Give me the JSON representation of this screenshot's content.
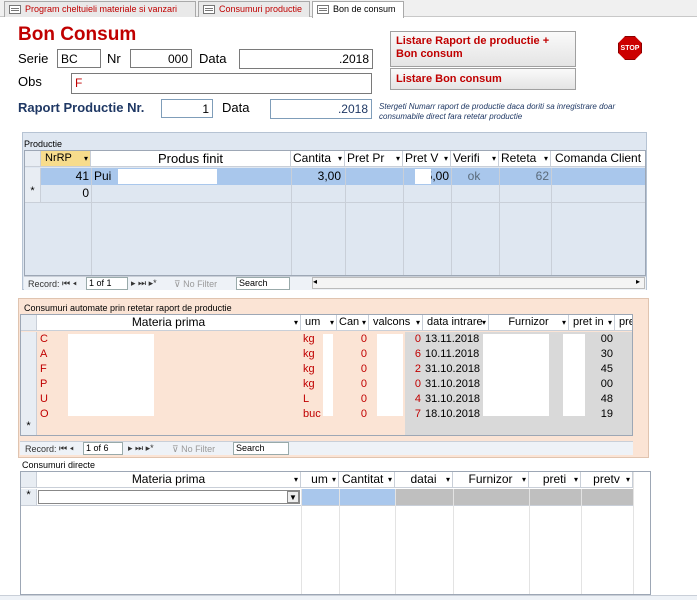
{
  "tabs": [
    {
      "label": "Program cheltuieli materiale si vanzari"
    },
    {
      "label": "Consumuri productie"
    },
    {
      "label": "Bon de consum"
    }
  ],
  "form": {
    "title": "Bon Consum",
    "serie_label": "Serie",
    "serie_value": "BC",
    "nr_label": "Nr",
    "nr_value": "000",
    "data_label": "Data",
    "data_value": ".2018",
    "obs_label": "Obs",
    "obs_value": "F",
    "raport_label": "Raport Productie Nr.",
    "raport_value": "1",
    "data2_label": "Data",
    "data2_value": ".2018",
    "hint": "Stergeti Numarr raport de productie daca doriti sa inregistrare doar consumabile direct fara retetar productie",
    "btn_listare_raport": "Listare Raport de productie + Bon consum",
    "btn_listare_bon": "Listare Bon consum",
    "stop_label": "STOP"
  },
  "productie": {
    "section_label": "Productie",
    "headers": [
      "NrRP",
      "Produs finit",
      "Cantita",
      "Pret Pr",
      "Pret V",
      "Verifi",
      "Reteta",
      "Comanda Client"
    ],
    "row": {
      "nrrp": "41",
      "produs": "Pui",
      "cantitate": "3,00",
      "pret_v": "5,00",
      "verif": "ok",
      "reteta": "62"
    },
    "new_row_value": "0",
    "nav": {
      "record_label": "Record:",
      "position": "1 of 1",
      "no_filter": "No Filter",
      "search": "Search"
    }
  },
  "consumuri_auto": {
    "section_label": "Consumuri automate prin retetar raport de productie",
    "headers": [
      "Materia prima",
      "um",
      "Can",
      "valcons",
      "data intrare",
      "Furnizor",
      "pret in",
      "pret"
    ],
    "rows": [
      {
        "mp": "C",
        "um": "kg",
        "cant": "0",
        "val": "0",
        "data": "13.11.2018",
        "pret_in": "00"
      },
      {
        "mp": "A",
        "um": "kg",
        "cant": "0",
        "val": "6",
        "data": "10.11.2018",
        "pret_in": "30"
      },
      {
        "mp": "F",
        "um": "kg",
        "cant": "0",
        "val": "2",
        "data": "31.10.2018",
        "pret_in": "45"
      },
      {
        "mp": "P",
        "um": "kg",
        "cant": "0",
        "val": "0",
        "data": "31.10.2018",
        "pret_in": "00"
      },
      {
        "mp": "U",
        "um": "L",
        "cant": "0",
        "val": "4",
        "data": "31.10.2018",
        "pret_in": "48"
      },
      {
        "mp": "O",
        "um": "buc",
        "cant": "0",
        "val": "7",
        "data": "18.10.2018",
        "pret_in": "19"
      }
    ],
    "nav": {
      "record_label": "Record:",
      "position": "1 of 6",
      "no_filter": "No Filter",
      "search": "Search"
    }
  },
  "consumuri_directe": {
    "section_label": "Consumuri directe",
    "headers": [
      "Materia prima",
      "um",
      "Cantitat",
      "datai",
      "Furnizor",
      "preti",
      "pretv"
    ]
  }
}
